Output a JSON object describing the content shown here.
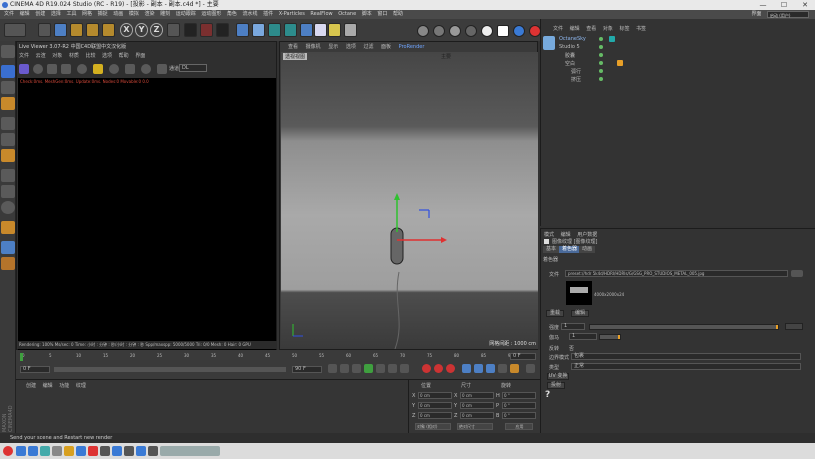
{
  "window": {
    "title": "CINEMA 4D R19.024 Studio (RC - R19) - [投影 - 副本 - 副本.c4d *] - 主要",
    "minimize": "—",
    "maximize": "☐",
    "close": "✕"
  },
  "menubar": {
    "items": [
      "文件",
      "编辑",
      "创建",
      "选择",
      "工具",
      "网格",
      "捕捉",
      "动画",
      "模拟",
      "渲染",
      "雕刻",
      "运动跟踪",
      "运动图形",
      "角色",
      "流水线",
      "插件",
      "X-Particles",
      "RealFlow",
      "Octane",
      "脚本",
      "窗口",
      "帮助"
    ],
    "layout_label": "界面",
    "layout_value": "启动 (用户)"
  },
  "toolbar": {
    "axis_x": "X",
    "axis_y": "Y",
    "axis_z": "Z"
  },
  "live_viewer": {
    "title": "Live Viewer 3.07-R2 中国C4D联盟中文汉化版",
    "menu": [
      "文件",
      "云渲",
      "对象",
      "材质",
      "比较",
      "选项",
      "帮助",
      "界面"
    ],
    "mode_label": "通道",
    "mode_value": "DL",
    "status_error": "Check:0ms. MeshGen:0ms. Update:0ms. Nodes:0 Movable:0  0.0",
    "render_status": "Rendering: 100%   Ms/sec: 0   Time: 小时 : 分钟 : 秒/小时 : 分钟 : 秒   Spp/maxspp: 5000/5000   Tri: 0/0   Mesh: 0   Hair: 0   GPU"
  },
  "viewport": {
    "menu": [
      "查看",
      "摄像机",
      "显示",
      "选项",
      "过滤",
      "面板",
      "ProRender"
    ],
    "active_tab": "ProRender",
    "label": "透视视图",
    "camera_label": "主要",
    "grid_distance": "网格间距 : 1000 cm"
  },
  "object_manager": {
    "menu": [
      "文件",
      "编辑",
      "查看",
      "对象",
      "标签",
      "书签"
    ],
    "objects": [
      {
        "name": "OctaneSky"
      },
      {
        "name": "Studio 5"
      },
      {
        "name": "胶囊"
      },
      {
        "name": "空白"
      },
      {
        "name": "弧行"
      },
      {
        "name": "挤压"
      }
    ]
  },
  "attributes": {
    "menu": [
      "模式",
      "编辑",
      "用户数据"
    ],
    "title": "图像纹理 [图像纹理]",
    "tabs": [
      "基本",
      "着色器",
      "动画"
    ],
    "active_tab": "着色器",
    "section": "着色器",
    "file_label": "文件",
    "file_path": "preset://hdr 5k4d/HDRI/HDRIs/G/GSG_PRO_STUDIOS_METAL_005.jpg",
    "image_size": "4000x2000x24",
    "buttons": [
      "重载",
      "编辑"
    ],
    "power_label": "强度",
    "power_value": "1",
    "gamma_label": "伽马",
    "gamma_value": "1",
    "invert_label": "反转",
    "invert_value": "否",
    "mode_label": "边界模式",
    "mode_value": "包裹",
    "type_label": "类型",
    "type_value": "正常",
    "uv_label": "UV 变换",
    "proj_label": "投射",
    "help": "?"
  },
  "timeline": {
    "ticks": [
      "0",
      "5",
      "10",
      "15",
      "20",
      "25",
      "30",
      "35",
      "40",
      "45",
      "50",
      "55",
      "60",
      "65",
      "70",
      "75",
      "80",
      "85",
      "90"
    ],
    "current_frame": "0 F",
    "start": "0 F",
    "end": "90 F",
    "frame_field": "0 F"
  },
  "materials": {
    "menu": [
      "创建",
      "编辑",
      "功能",
      "纹理"
    ]
  },
  "coordinates": {
    "headers": [
      "位置",
      "尺寸",
      "旋转"
    ],
    "rows": [
      {
        "axis": "X",
        "pos": "0 cm",
        "size": "0 cm",
        "rot_axis": "H",
        "rot": "0 °"
      },
      {
        "axis": "Y",
        "pos": "0 cm",
        "size": "0 cm",
        "rot_axis": "P",
        "rot": "0 °"
      },
      {
        "axis": "Z",
        "pos": "0 cm",
        "size": "0 cm",
        "rot_axis": "B",
        "rot": "0 °"
      }
    ],
    "object_mode": "对象 (相对)",
    "size_mode": "绝对尺寸",
    "apply": "应用"
  },
  "statusbar": {
    "text": "Send your scene and Restart new render"
  },
  "colors": {
    "accent": "#4a7fd0",
    "error": "#d94a3a",
    "active_tab": "#6fa4ff"
  }
}
